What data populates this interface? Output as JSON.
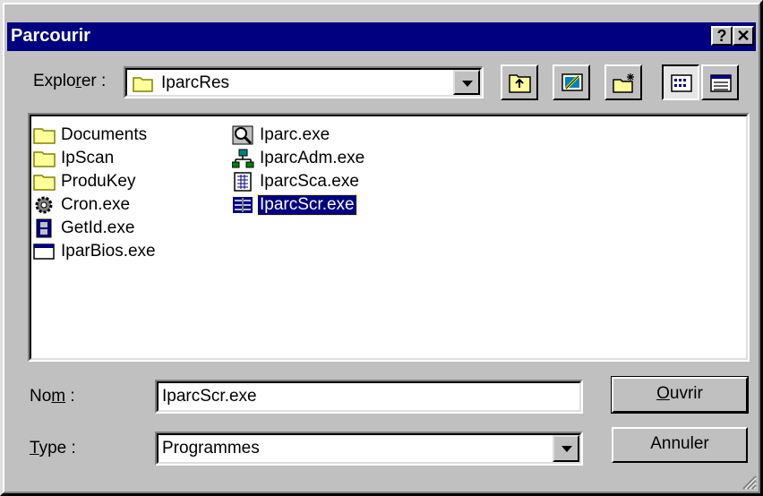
{
  "window": {
    "title": "Parcourir",
    "help_label": "?",
    "close_label": "✕"
  },
  "lookin": {
    "label_pre": "Explo",
    "label_accel": "r",
    "label_post": "er :",
    "value": "IparcRes"
  },
  "toolbar": {
    "icons": [
      "up-folder-icon",
      "desktop-icon",
      "new-folder-icon",
      "list-view-icon",
      "details-view-icon"
    ]
  },
  "files": {
    "col1": [
      {
        "name": "Documents",
        "icon": "folder-icon"
      },
      {
        "name": "IpScan",
        "icon": "folder-icon"
      },
      {
        "name": "ProduKey",
        "icon": "folder-icon"
      },
      {
        "name": "Cron.exe",
        "icon": "gear-icon"
      },
      {
        "name": "GetId.exe",
        "icon": "film-icon"
      },
      {
        "name": "IparBios.exe",
        "icon": "window-icon"
      }
    ],
    "col2": [
      {
        "name": "Iparc.exe",
        "icon": "magnifier-icon"
      },
      {
        "name": "IparcAdm.exe",
        "icon": "network-icon"
      },
      {
        "name": "IparcSca.exe",
        "icon": "document-grid-icon"
      },
      {
        "name": "IparcScr.exe",
        "icon": "scroll-icon",
        "selected": true
      }
    ]
  },
  "name_field": {
    "label_pre": "No",
    "label_accel": "m",
    "label_post": " :",
    "value": "IparcScr.exe"
  },
  "type_field": {
    "label_accel": "T",
    "label_post": "ype :",
    "value": "Programmes"
  },
  "buttons": {
    "open_accel": "O",
    "open_rest": "uvrir",
    "cancel": "Annuler"
  },
  "colors": {
    "title_bar": "#000080",
    "face": "#c0c0c0",
    "selection": "#000080"
  }
}
